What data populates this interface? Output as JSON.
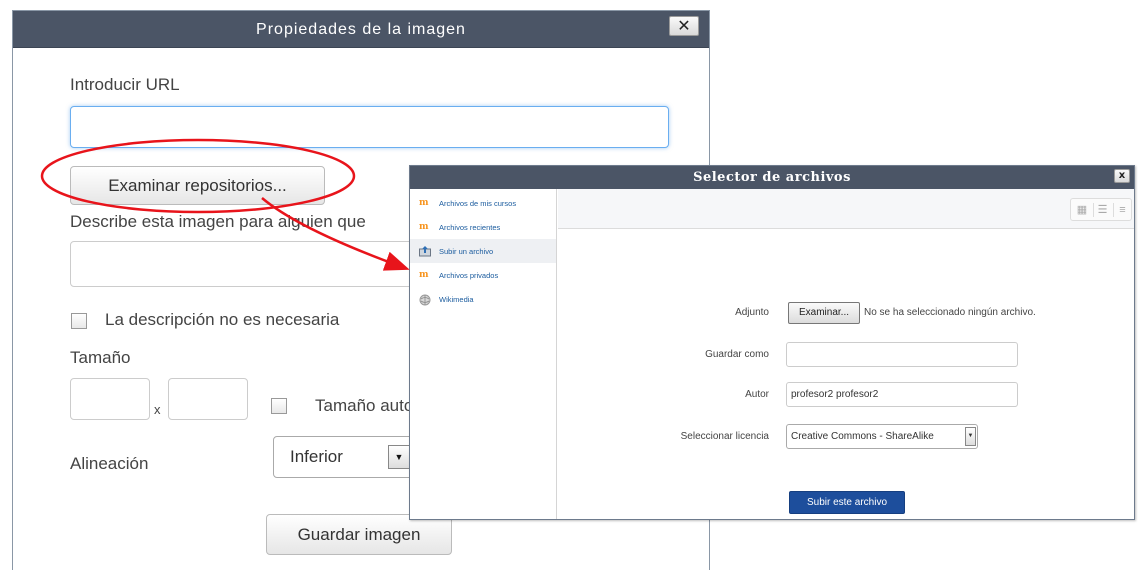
{
  "image_dialog": {
    "title": "Propiedades de la imagen",
    "close_label": "✕",
    "url_label": "Introducir URL",
    "url_value": "",
    "browse_button": "Examinar repositorios...",
    "describe_label": "Describe esta imagen para alguien que",
    "describe_value": "",
    "no_desc_label": "La descripción no es necesaria",
    "size_label": "Tamaño",
    "size_x": "x",
    "auto_size_label": "Tamaño automático",
    "align_label": "Alineación",
    "align_value": "Inferior",
    "save_button": "Guardar imagen"
  },
  "file_picker": {
    "title": "Selector de archivos",
    "close_label": "x",
    "sidebar": [
      {
        "label": "Archivos de mis cursos",
        "icon": "moodle-icon"
      },
      {
        "label": "Archivos recientes",
        "icon": "moodle-icon"
      },
      {
        "label": "Subir un archivo",
        "icon": "upload-icon",
        "active": true
      },
      {
        "label": "Archivos privados",
        "icon": "moodle-icon"
      },
      {
        "label": "Wikimedia",
        "icon": "wikimedia-icon"
      }
    ],
    "form": {
      "attachment_label": "Adjunto",
      "browse_button": "Examinar...",
      "no_file_text": "No se ha seleccionado ningún archivo.",
      "save_as_label": "Guardar como",
      "save_as_value": "",
      "author_label": "Autor",
      "author_value": "profesor2 profesor2",
      "license_label": "Seleccionar licencia",
      "license_value": "Creative Commons - ShareAlike",
      "upload_button": "Subir este archivo"
    }
  },
  "colors": {
    "titlebar": "#4b5566",
    "annotation": "#e8141b",
    "primary_button": "#1d4e9c",
    "link": "#1a5b9e",
    "focus_border": "#6aaef0"
  }
}
